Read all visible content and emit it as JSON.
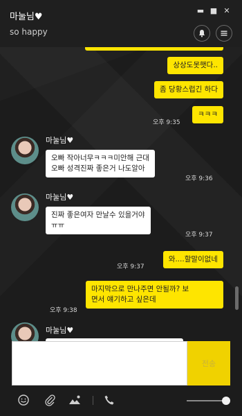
{
  "header": {
    "title": "마눌님♥",
    "subtitle": "so happy",
    "minimize_glyph": "▬",
    "maximize_glyph": "■",
    "close_glyph": "✕"
  },
  "messages": {
    "m1": {
      "text": "상상도못햇다.."
    },
    "m2": {
      "text": "좀 당황스럽긴 하다"
    },
    "m3": {
      "text": "ㅋㅋㅋ",
      "time": "오후 9:35"
    },
    "g1": {
      "sender": "마눌님♥",
      "line1": "오빠 작아너무ㅋㅋㅋ미안해 근대",
      "line2": "오빠 성격진짜 좋은거 나도알아",
      "time": "오후 9:36"
    },
    "g2": {
      "sender": "마눌님♥",
      "line1": "진짜 좋은여자 만날수 있을거야",
      "line2": "ㅠㅠ",
      "time": "오후 9:37"
    },
    "m4": {
      "text": "와....할말이없네",
      "time": "오후 9:37"
    },
    "m5": {
      "line1": "마지막으로 만나주면 안될까? 보",
      "line2": "면서 얘기하고 싶은데",
      "time": "오후 9:38"
    },
    "g3": {
      "sender": "마눌님♥"
    }
  },
  "input": {
    "send_label": "전송"
  },
  "colors": {
    "my_bubble": "#fee500",
    "their_bubble": "#ffffff",
    "background": "#1c1c1c",
    "send_button": "#f0d200"
  },
  "icons": [
    "bell-icon",
    "menu-icon",
    "emoji-icon",
    "attachment-icon",
    "image-icon",
    "phone-icon"
  ]
}
